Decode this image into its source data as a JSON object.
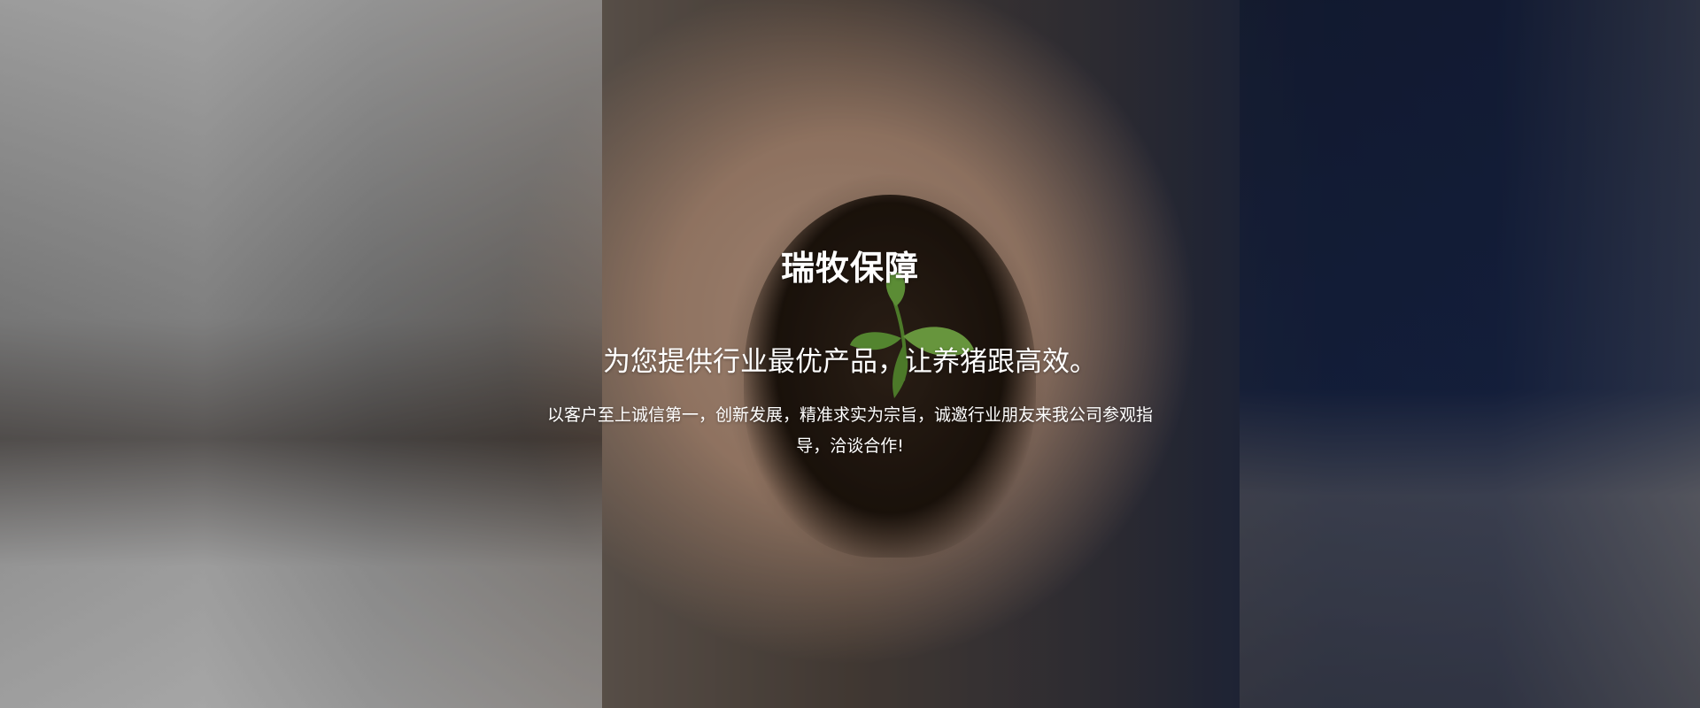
{
  "hero": {
    "title": "瑞牧保障",
    "subtitle": "为您提供行业最优产品，让养猪跟高效。",
    "description": "以客户至上诚信第一，创新发展，精准求实为宗旨，诚邀行业朋友来我公司参观指导，洽谈合作!"
  },
  "icons": [
    "sprout-icon"
  ],
  "colors": {
    "text": "#ffffff",
    "leaf": "#7fc34a"
  }
}
